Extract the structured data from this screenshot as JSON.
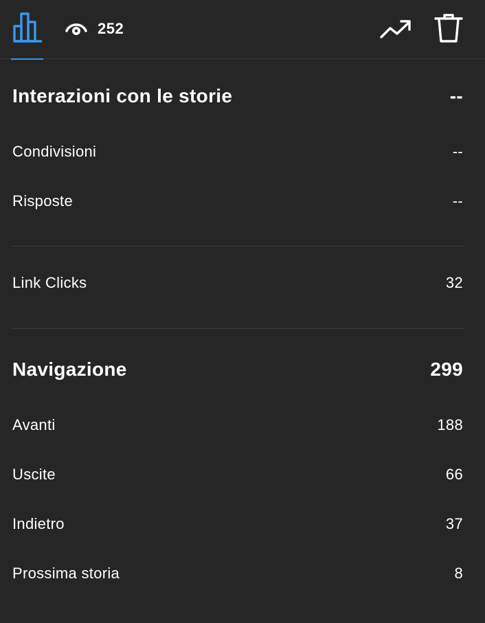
{
  "topbar": {
    "views_count": "252"
  },
  "interactions": {
    "title": "Interazioni con le storie",
    "total": "--",
    "rows": [
      {
        "label": "Condivisioni",
        "value": "--"
      },
      {
        "label": "Risposte",
        "value": "--"
      }
    ]
  },
  "link_clicks": {
    "label": "Link Clicks",
    "value": "32"
  },
  "navigation": {
    "title": "Navigazione",
    "total": "299",
    "rows": [
      {
        "label": "Avanti",
        "value": "188"
      },
      {
        "label": "Uscite",
        "value": "66"
      },
      {
        "label": "Indietro",
        "value": "37"
      },
      {
        "label": "Prossima storia",
        "value": "8"
      }
    ]
  },
  "colors": {
    "background": "#262626",
    "accent": "#3897f0",
    "text": "#ffffff",
    "divider": "#3d3d3d"
  },
  "icons": [
    "bar-chart-icon",
    "eye-icon",
    "trending-up-icon",
    "trash-icon"
  ]
}
